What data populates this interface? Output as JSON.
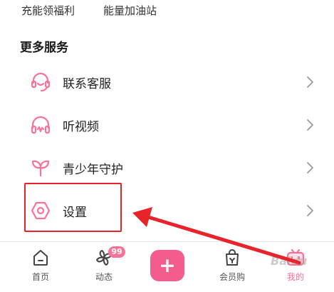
{
  "top_links": [
    {
      "label": "充能领福利"
    },
    {
      "label": "能量加油站"
    }
  ],
  "section": {
    "title": "更多服务"
  },
  "menu": {
    "items": [
      {
        "label": "联系客服",
        "icon": "headset-icon"
      },
      {
        "label": "听视频",
        "icon": "headphones-icon"
      },
      {
        "label": "青少年守护",
        "icon": "sprout-icon"
      },
      {
        "label": "设置",
        "icon": "hexagon-settings-icon"
      }
    ]
  },
  "tabbar": {
    "items": [
      {
        "label": "首页",
        "icon": "home-icon"
      },
      {
        "label": "动态",
        "icon": "pinwheel-icon",
        "badge": "99"
      },
      {
        "label": "会员购",
        "icon": "shopping-bag-icon"
      },
      {
        "label": "我的",
        "icon": "tv-face-icon",
        "active": true
      }
    ],
    "publish": {
      "label": "+"
    }
  },
  "watermark": {
    "text": "Baidu"
  },
  "colors": {
    "accent": "#fb7299",
    "publish": "#f25d8e",
    "annotation": "#e8232a",
    "chevron": "#9a9a9a"
  }
}
